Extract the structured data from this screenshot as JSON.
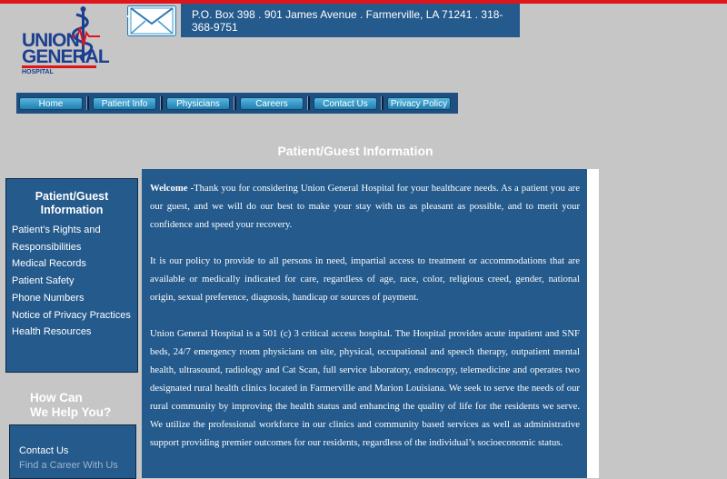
{
  "logo": {
    "line1": "UNION",
    "line2": "GENERAL",
    "line3": "HOSPITAL",
    "icon": "caduceus-logo-icon"
  },
  "contact": {
    "icon": "envelope-icon",
    "address": "P.O. Box 398 . 901 James Avenue . Farmerville, LA 71241 . 318-368-9751"
  },
  "nav": {
    "items": [
      "Home",
      "Patient Info",
      "Physicians",
      "Careers",
      "Contact Us",
      "Privacy Policy"
    ]
  },
  "page": {
    "title": "Patient/Guest Information"
  },
  "sidebar": {
    "heading": "Patient/Guest Information",
    "items": [
      "Patient’s Rights and Responsibilities",
      "Medical Records",
      "Patient Safety",
      "Phone Numbers",
      "Notice of Privacy Practices",
      "Health Resources"
    ]
  },
  "help": {
    "heading_line1": "How Can",
    "heading_line2": "We Help You?",
    "items": [
      "Contact Us",
      "Find a Career With Us"
    ]
  },
  "content": {
    "welcome_label": "Welcome -",
    "welcome_text": "Thank you for considering Union General Hospital for your healthcare needs. As a patient you are our guest, and we will do our best to make your stay with us as pleasant as possible, and to merit your confidence and speed your recovery.",
    "policy": "It is our policy to provide to all persons in need, impartial access to treatment or accommodations that are available or medically indicated for care, regardless of age, race, color, religious creed, gender, national origin, sexual preference, diagnosis, handicap or sources of payment.",
    "about": "Union General Hospital is a 501 (c) 3 critical access hospital. The Hospital provides acute inpatient and SNF beds, 24/7 emergency room physicians on site, physical, occupational and speech therapy, outpatient mental health, ultrasound, radiology and Cat Scan, full service laboratory, endoscopy, telemedicine and operates two designated rural health clinics located in Farmerville and Marion Louisiana. We seek to serve the needs of our rural community by improving the health status and enhancing the quality of life for the residents we serve. We utilize the professional workforce in our clinics and community based services as well as administrative support providing premier outcomes for our residents, regardless of the individual’s socioeconomic status."
  },
  "colors": {
    "background": "#c6c6c6",
    "panel": "#245a8c",
    "accent": "#e0141b",
    "brand": "#1d3f8f"
  }
}
